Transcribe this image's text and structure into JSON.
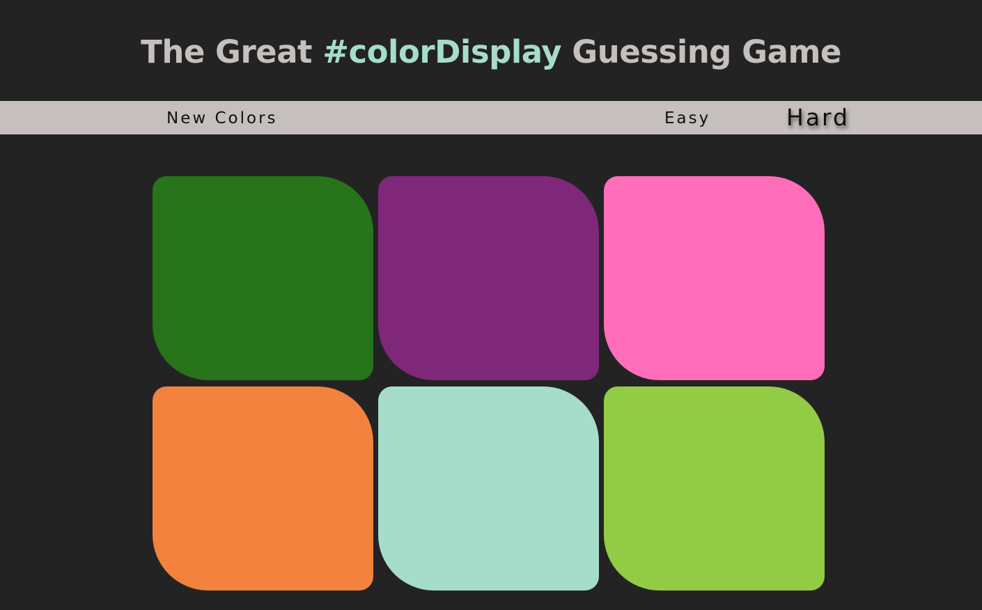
{
  "header": {
    "title_before": "The Great ",
    "title_highlight": "#colorDisplay",
    "title_after": " Guessing Game",
    "highlight_color": "#a6dcca"
  },
  "toolbar": {
    "new_colors_label": "New Colors",
    "easy_label": "Easy",
    "hard_label": "Hard",
    "selected_mode": "Hard"
  },
  "board": {
    "squares": [
      {
        "color": "#27741a"
      },
      {
        "color": "#7f2879"
      },
      {
        "color": "#ff6dbb"
      },
      {
        "color": "#f2823d"
      },
      {
        "color": "#a6dcca"
      },
      {
        "color": "#92cb44"
      }
    ]
  }
}
